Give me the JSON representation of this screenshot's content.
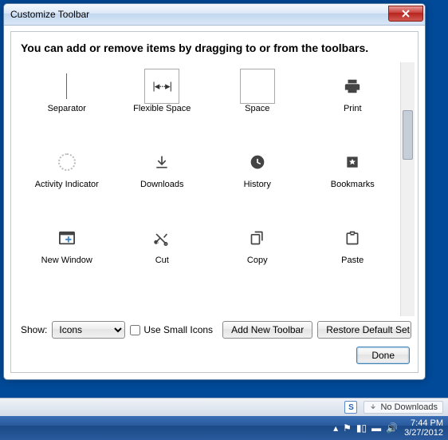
{
  "dialog": {
    "title": "Customize Toolbar",
    "instruction": "You can add or remove items by dragging to or from the toolbars.",
    "items": {
      "separator": "Separator",
      "flexible_space": "Flexible Space",
      "space": "Space",
      "print": "Print",
      "activity_indicator": "Activity Indicator",
      "downloads": "Downloads",
      "history": "History",
      "bookmarks": "Bookmarks",
      "new_window": "New Window",
      "cut": "Cut",
      "copy": "Copy",
      "paste": "Paste"
    },
    "show_label": "Show:",
    "show_value": "Icons",
    "use_small_icons": "Use Small Icons",
    "add_new_toolbar": "Add New Toolbar",
    "restore_default": "Restore Default Set",
    "done": "Done"
  },
  "statusbar": {
    "s_badge": "S",
    "no_downloads": "No Downloads"
  },
  "taskbar": {
    "time": "7:44 PM",
    "date": "3/27/2012"
  }
}
